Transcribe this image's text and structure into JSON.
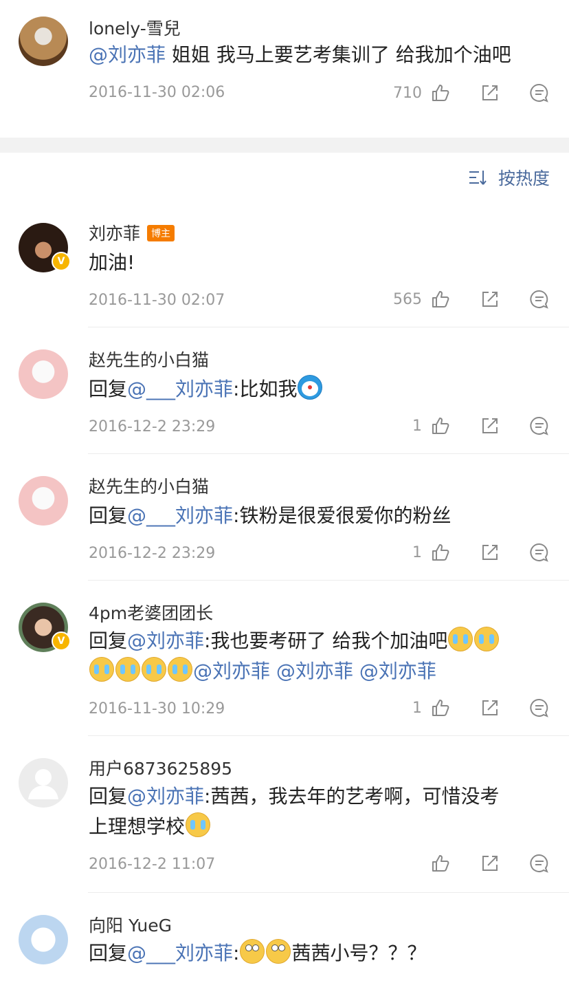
{
  "post": {
    "username": "lonely-雪兒",
    "mention": "@刘亦菲",
    "text": " 姐姐 我马上要艺考集训了 给我加个油吧",
    "time": "2016-11-30 02:06",
    "likes": "710"
  },
  "sort": {
    "label": "按热度",
    "icon": "sort-icon"
  },
  "comments": [
    {
      "username": "刘亦菲",
      "badge": "博主",
      "verified": true,
      "text": "加油!",
      "time": "2016-11-30 02:07",
      "likes": "565"
    },
    {
      "username": "赵先生的小白猫",
      "prefix": "回复",
      "mention": "@___刘亦菲",
      "text": ":比如我",
      "emoji": "doraemon-emoji",
      "time": "2016-12-2 23:29",
      "likes": "1"
    },
    {
      "username": "赵先生的小白猫",
      "prefix": "回复",
      "mention": "@___刘亦菲",
      "text": ":铁粉是很爱很爱你的粉丝",
      "time": "2016-12-2 23:29",
      "likes": "1"
    },
    {
      "username": "4pm老婆团团长",
      "verified": true,
      "prefix": "回复",
      "mention": "@刘亦菲",
      "text": ":我也要考研了 给我个加油吧",
      "extra_mentions": [
        "@刘亦菲",
        "@刘亦菲",
        "@刘亦菲"
      ],
      "emoji": "crying-emoji",
      "time": "2016-11-30 10:29",
      "likes": "1"
    },
    {
      "username": "用户6873625895",
      "prefix": "回复",
      "mention": "@刘亦菲",
      "text": ":茜茜，我去年的艺考啊，可惜没考",
      "text2": "上理想学校",
      "emoji": "crying-emoji",
      "time": "2016-12-2 11:07",
      "likes": ""
    },
    {
      "username": "向阳 YueG",
      "prefix": "回复",
      "mention": "@___刘亦菲",
      "text": ":",
      "text_after": "茜茜小号？？？",
      "emoji": "eye-roll-emoji"
    }
  ],
  "icons": {
    "like": "thumbs-up-icon",
    "share": "share-icon",
    "comment": "comment-icon"
  },
  "colors": {
    "mention": "#4a73b5",
    "muted": "#999999",
    "badge": "#f57c00",
    "verified": "#f7b500"
  }
}
